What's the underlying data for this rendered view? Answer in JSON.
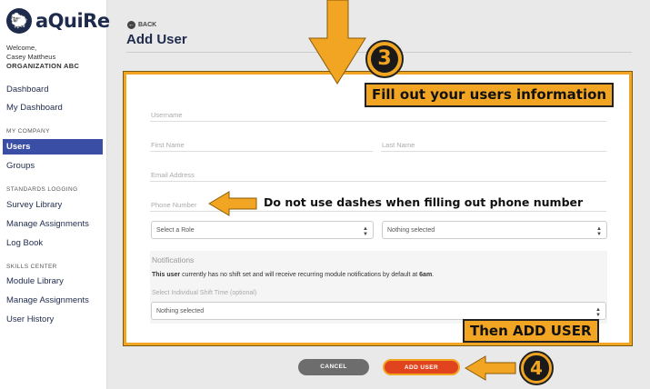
{
  "app": {
    "logo_mark": "🐑",
    "logo_text": "aQuiRe"
  },
  "user": {
    "welcome": "Welcome,",
    "name": "Casey Mattheus",
    "org": "ORGANIZATION ABC"
  },
  "sidebar": {
    "dashboard": "Dashboard",
    "my_dashboard": "My Dashboard",
    "section_company": "MY COMPANY",
    "users": "Users",
    "groups": "Groups",
    "section_standards": "STANDARDS LOGGING",
    "survey_library": "Survey Library",
    "manage_assignments_1": "Manage Assignments",
    "log_book": "Log Book",
    "section_skills": "SKILLS CENTER",
    "module_library": "Module Library",
    "manage_assignments_2": "Manage Assignments",
    "user_history": "User History"
  },
  "header": {
    "back": "BACK",
    "title": "Add User"
  },
  "form": {
    "username": "Username",
    "first_name": "First Name",
    "last_name": "Last Name",
    "email": "Email Address",
    "phone": "Phone Number",
    "role_select": "Select a Role",
    "group_select": "Nothing selected",
    "notifications_title": "Notifications",
    "notif_bold": "This user",
    "notif_text": " currently has no shift set and will receive recurring module notifications by default at ",
    "notif_time": "6am",
    "notif_end": ".",
    "shift_label": "Select Individual Shift Time (optional)",
    "shift_select": "Nothing selected"
  },
  "buttons": {
    "cancel": "CANCEL",
    "add_user": "ADD USER"
  },
  "annotations": {
    "step3": "3",
    "step4": "4",
    "callout_fill": "Fill out your users information",
    "note_phone": "Do not use dashes when filling out phone number",
    "callout_add": "Then ADD USER"
  },
  "colors": {
    "accent": "#f1a523",
    "brand": "#1f2b4d",
    "active": "#3b4ea6",
    "primary_button": "#e0431e"
  }
}
